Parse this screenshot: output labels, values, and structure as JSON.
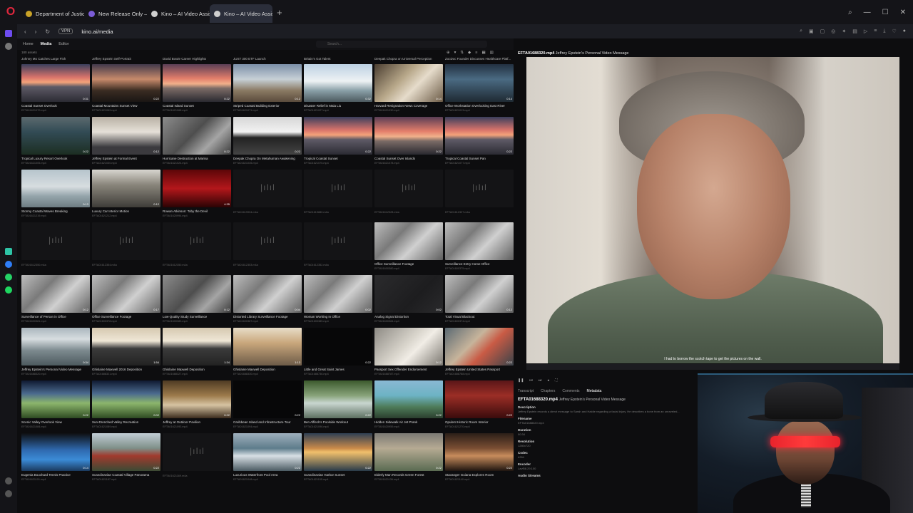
{
  "browser": {
    "tabs": [
      {
        "label": "Department of Justice | Ho",
        "color": "#c9a227"
      },
      {
        "label": "New Release Only — JDrive",
        "color": "#7b5cd6"
      },
      {
        "label": "Kino – AI Video Assistant",
        "color": "#cfcfcf"
      },
      {
        "label": "Kino – AI Video Assistant",
        "color": "#cfcfcf",
        "active": true
      }
    ],
    "vpn": "VPN",
    "url": "kino.ai/media"
  },
  "nav": {
    "home": "Home",
    "media": "Media",
    "editor": "Editor",
    "search_placeholder": "Search..."
  },
  "asset_count": "180 assets",
  "top_row_labels": [
    "Johnny Mo Catches Large Fish",
    "Jeffrey Epstein Self-Portrait",
    "David Bowie Career Highlights",
    "JUST 300 ETF Launch",
    "Britain's Got Talent",
    "Deepak Chopra on Universal Perception",
    "ZocDoc Founder Discusses Healthcare Platf..."
  ],
  "grid": [
    {
      "label": "Coastal Sunset Overlook",
      "file": "EFTA01621070.mp4",
      "dur": "0:31",
      "thumb": "t-sunset"
    },
    {
      "label": "Coastal Mountains Sunset View",
      "file": "EFTA01621069.mp4",
      "dur": "0:22",
      "thumb": "t-palm"
    },
    {
      "label": "Coastal Island Sunset",
      "file": "EFTA01621068.mp4",
      "dur": "0:22",
      "thumb": "t-sunset2"
    },
    {
      "label": "Striped Coastal Building Exterior",
      "file": "EFTA01621071.mp4",
      "dur": "0:12",
      "thumb": "t-bldg"
    },
    {
      "label": "Disaster Relief in Maia Liu",
      "file": "EFTA01621027.mp4",
      "dur": "0:32",
      "thumb": "t-harbor"
    },
    {
      "label": "Harvard Resignation News Coverage",
      "file": "EFTA01621030.mp4",
      "dur": "0:14",
      "thumb": "t-news"
    },
    {
      "label": "Office Workstation Overlooking East River",
      "file": "EFTA01621013.mp4",
      "dur": "0:14",
      "thumb": "t-office"
    },
    {
      "label": "Tropical Luxury Resort Overlook",
      "file": "EFTA01621005.mp4",
      "dur": "0:22",
      "thumb": "t-resort"
    },
    {
      "label": "Jeffrey Epstein at Formal Event",
      "file": "EFTA01621030.mp4",
      "dur": "0:12",
      "thumb": "t-formal"
    },
    {
      "label": "Hurricane Destruction at Marina",
      "file": "EFTA01621024.mp4",
      "dur": "0:22",
      "thumb": "t-cctvd"
    },
    {
      "label": "Deepak Chopra On Metahuman Awakening",
      "file": "EFTA01621035.mp4",
      "dur": "0:22",
      "thumb": "t-guy"
    },
    {
      "label": "Tropical Coastal Sunset",
      "file": "EFTA01621075.mp4",
      "dur": "0:22",
      "thumb": "t-sunset"
    },
    {
      "label": "Coastal Sunset Over Islands",
      "file": "EFTA01621078.mp4",
      "dur": "0:22",
      "thumb": "t-sunset2"
    },
    {
      "label": "Tropical Coastal Sunset Pan",
      "file": "EFTA01621077.mp4",
      "dur": "0:22",
      "thumb": "t-sunset"
    },
    {
      "label": "Stormy Coastal Waves Breaking",
      "file": "EFTA01621219.mp4",
      "dur": "0:13",
      "thumb": "t-wave"
    },
    {
      "label": "Luxury Car Interior Motion",
      "file": "EFTA01621212.mp4",
      "dur": "0:12",
      "thumb": "t-car"
    },
    {
      "label": "Rowan Atkinson: Toby the Devil",
      "file": "EFTA01620994.mp4",
      "dur": "4:35",
      "thumb": "t-red"
    },
    {
      "label": "",
      "file": "EFTA01619904.m4a",
      "dur": "",
      "thumb": "audio"
    },
    {
      "label": "",
      "file": "EFTA01619880.m4a",
      "dur": "",
      "thumb": "audio"
    },
    {
      "label": "",
      "file": "EFTA01612328.m4a",
      "dur": "",
      "thumb": "audio"
    },
    {
      "label": "",
      "file": "EFTA01612327.m4a",
      "dur": "",
      "thumb": "audio"
    },
    {
      "label": "",
      "file": "EFTA01612350.m4a",
      "dur": "",
      "thumb": "audio"
    },
    {
      "label": "",
      "file": "EFTA01612354.m4a",
      "dur": "",
      "thumb": "audio"
    },
    {
      "label": "",
      "file": "EFTA01612350.m4a",
      "dur": "",
      "thumb": "audio"
    },
    {
      "label": "",
      "file": "EFTA01612353.m4a",
      "dur": "",
      "thumb": "audio"
    },
    {
      "label": "",
      "file": "EFTA01612352.m4a",
      "dur": "",
      "thumb": "audio"
    },
    {
      "label": "Office Surveillance Footage",
      "file": "EFTA01600380.mp4",
      "dur": "",
      "thumb": "t-cctv"
    },
    {
      "label": "Surveillance Entry Home Office",
      "file": "EFTA01600375.mp4",
      "dur": "",
      "thumb": "t-cctv"
    },
    {
      "label": "Surveillance of Person in Office",
      "file": "EFTA01600381.mp4",
      "dur": "0:12",
      "thumb": "t-cctv"
    },
    {
      "label": "Office Surveillance Footage",
      "file": "EFTA01600378.mp4",
      "dur": "0:17",
      "thumb": "t-cctv"
    },
    {
      "label": "Low-Quality Study Surveillance",
      "file": "EFTA01600383.mp4",
      "dur": "0:12",
      "thumb": "t-cctvd"
    },
    {
      "label": "Distorted Library Surveillance Footage",
      "file": "EFTA01600387.mp4",
      "dur": "0:04",
      "thumb": "t-cctv"
    },
    {
      "label": "Woman Working In Office",
      "file": "EFTA01600385.mp4",
      "dur": "0:02",
      "thumb": "t-cctv"
    },
    {
      "label": "Analog Signal Distortion",
      "file": "EFTA01600384.mp4",
      "dur": "0:02",
      "thumb": "t-dim"
    },
    {
      "label": "Total Visual Blackout",
      "file": "EFTA01600374.mp4",
      "dur": "0:12",
      "thumb": "t-cctv"
    },
    {
      "label": "Jeffrey Epstein's Personal Video Message",
      "file": "EFTA01688320.mp4",
      "dur": "0:34",
      "thumb": "t-interview"
    },
    {
      "label": "Ghislaine Maxwell 2016 Deposition",
      "file": "EFTA01688321.mp4",
      "dur": "1:54",
      "thumb": "t-depo"
    },
    {
      "label": "Ghislaine Maxwell Deposition",
      "file": "EFTA01688327.mp4",
      "dur": "1:34",
      "thumb": "t-depo"
    },
    {
      "label": "Ghislaine Maxwell Deposition",
      "file": "EFTA01688330.mp4",
      "dur": "1:13",
      "thumb": "t-depo2"
    },
    {
      "label": "Little and Great Saint James",
      "file": "EFTA01688736.mp4",
      "dur": "0:22",
      "thumb": "black"
    },
    {
      "label": "Passport Sex Offender Endorsement",
      "file": "EFTA01688787.mp4",
      "dur": "0:12",
      "thumb": "t-paper"
    },
    {
      "label": "Jeffrey Epstein United States Passport",
      "file": "EFTA01688788.mp4",
      "dur": "0:22",
      "thumb": "t-passport"
    },
    {
      "label": "Scenic Valley Overlook View",
      "file": "EFTA01621084.mp4",
      "dur": "0:22",
      "thumb": "t-valley"
    },
    {
      "label": "Sun-Drenched Valley Recreation",
      "file": "EFTA01621089.mp4",
      "dur": "0:02",
      "thumb": "t-valley"
    },
    {
      "label": "Jeffrey at Outdoor Pavilion",
      "file": "EFTA01621093.mp4",
      "dur": "0:22",
      "thumb": "t-pav"
    },
    {
      "label": "Caribbean Island and Infrastructure Tour",
      "file": "EFTA01621094.mp4",
      "dur": "0:22",
      "thumb": "black"
    },
    {
      "label": "Ben Affleck's Poolside Workout",
      "file": "EFTA01621096.mp4",
      "dur": "0:22",
      "thumb": "t-pool"
    },
    {
      "label": "Hidden Sidewalk Air Jet Prank",
      "file": "EFTA01620959.mp4",
      "dur": "0:22",
      "thumb": "t-sidewalk"
    },
    {
      "label": "Opulent Historic Room Interior",
      "file": "EFTA01621270.mp4",
      "dur": "0:22",
      "thumb": "t-opulent"
    },
    {
      "label": "Eugenia Bouchard Tennis Practice",
      "file": "EFTA01621101.mp4",
      "dur": "0:14",
      "thumb": "t-tennis"
    },
    {
      "label": "Scandinavian Coastal Village Panorama",
      "file": "EFTA01621187.mp4",
      "dur": "0:22",
      "thumb": "t-village"
    },
    {
      "label": "",
      "file": "EFTA01621169.m4a",
      "dur": "",
      "thumb": "audio"
    },
    {
      "label": "Luxurious Waterfront Pool Area",
      "file": "EFTA01621048.mp4",
      "dur": "0:22",
      "thumb": "t-waterfront"
    },
    {
      "label": "Scandinavian Harbor Sunset",
      "file": "EFTA01621155.mp4",
      "dur": "0:22",
      "thumb": "t-harborsun"
    },
    {
      "label": "Elderly Man Records Green Forest",
      "file": "EFTA01621136.mp4",
      "dur": "0:22",
      "thumb": "t-elderly"
    },
    {
      "label": "Stavanger Guiana Explores Room",
      "file": "EFTA01621140.mp4",
      "dur": "0:22",
      "thumb": "t-boathouse"
    }
  ],
  "player": {
    "filename": "EFTA01688320.mp4",
    "title": "Jeffrey Epstein's Personal Video Message",
    "subtitle": "I had to borrow the scotch tape to get the pictures on the wall."
  },
  "panel": {
    "tabs": [
      "Transcript",
      "Chapters",
      "Comments",
      "Metadata"
    ],
    "active_tab": "Metadata",
    "description_label": "Description",
    "description": "Jeffrey Epstein records a direct message to Sarah and Haidie regarding a facial injury. He describes a bone from an unraveled...",
    "fields": [
      {
        "k": "Filename",
        "v": "EFTA01688320.mp4"
      },
      {
        "k": "Duration",
        "v": "00:34"
      },
      {
        "k": "Resolution",
        "v": "1280x720"
      },
      {
        "k": "Codec",
        "v": "h264"
      },
      {
        "k": "Encoder",
        "v": "Lavf58.29.100"
      },
      {
        "k": "Audio Streams",
        "v": ""
      }
    ]
  }
}
